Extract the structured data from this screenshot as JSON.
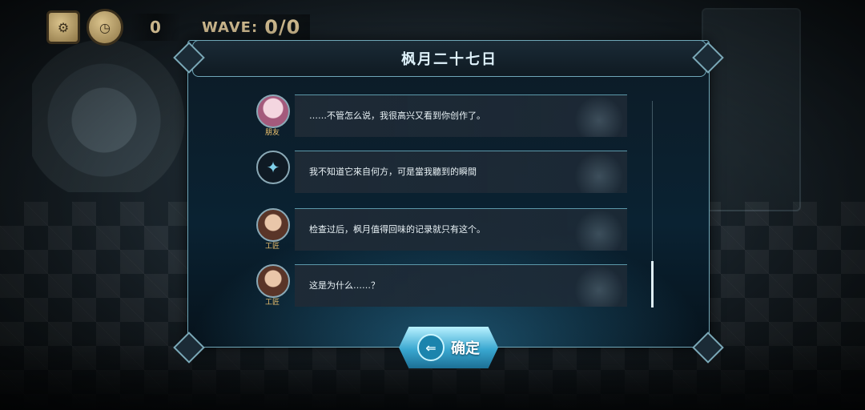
{
  "hud": {
    "settings_icon": "gear-icon",
    "speed_icon": "clock-icon",
    "gold": "0",
    "wave_label": "WAVE:",
    "wave_value": "0/0"
  },
  "dialog": {
    "title": "枫月二十七日",
    "messages": [
      {
        "speaker": "朋友",
        "avatar": "friend-avatar",
        "text": "……不管怎么说，我很高兴又看到你创作了。"
      },
      {
        "speaker": "",
        "avatar": "emblem-avatar",
        "text": "我不知道它來自何方，可是當我聽到的瞬間"
      },
      {
        "speaker": "工匠",
        "avatar": "craftsman-avatar",
        "text": "检查过后，枫月值得回味的记录就只有这个。"
      },
      {
        "speaker": "工匠",
        "avatar": "craftsman-avatar",
        "text": "这是为什么……？"
      }
    ],
    "confirm_label": "确定",
    "confirm_icon": "arrow-left-icon"
  }
}
